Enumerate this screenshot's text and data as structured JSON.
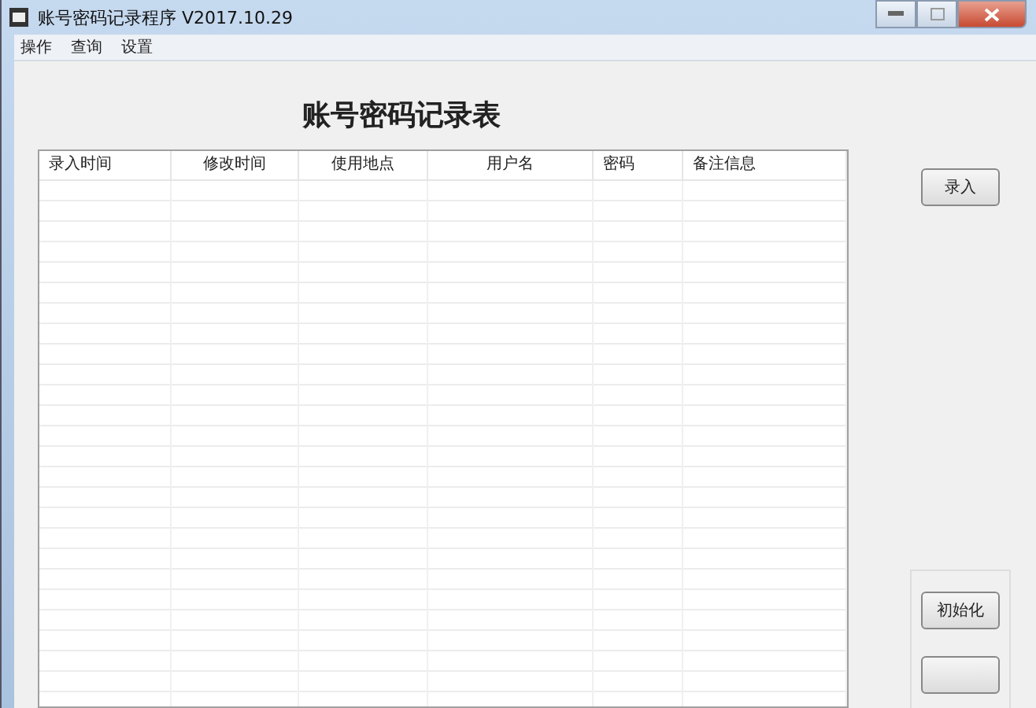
{
  "window": {
    "title": "账号密码记录程序 V2017.10.29"
  },
  "menu": [
    "操作",
    "查询",
    "设置"
  ],
  "heading": "账号密码记录表",
  "table": {
    "columns": [
      "录入时间",
      "修改时间",
      "使用地点",
      "用户名",
      "密码",
      "备注信息"
    ]
  },
  "buttons": [
    {
      "label": "录入"
    }
  ],
  "group_buttons": [
    {
      "kind": "button",
      "label": "初始化"
    },
    {
      "kind": "button"
    }
  ]
}
